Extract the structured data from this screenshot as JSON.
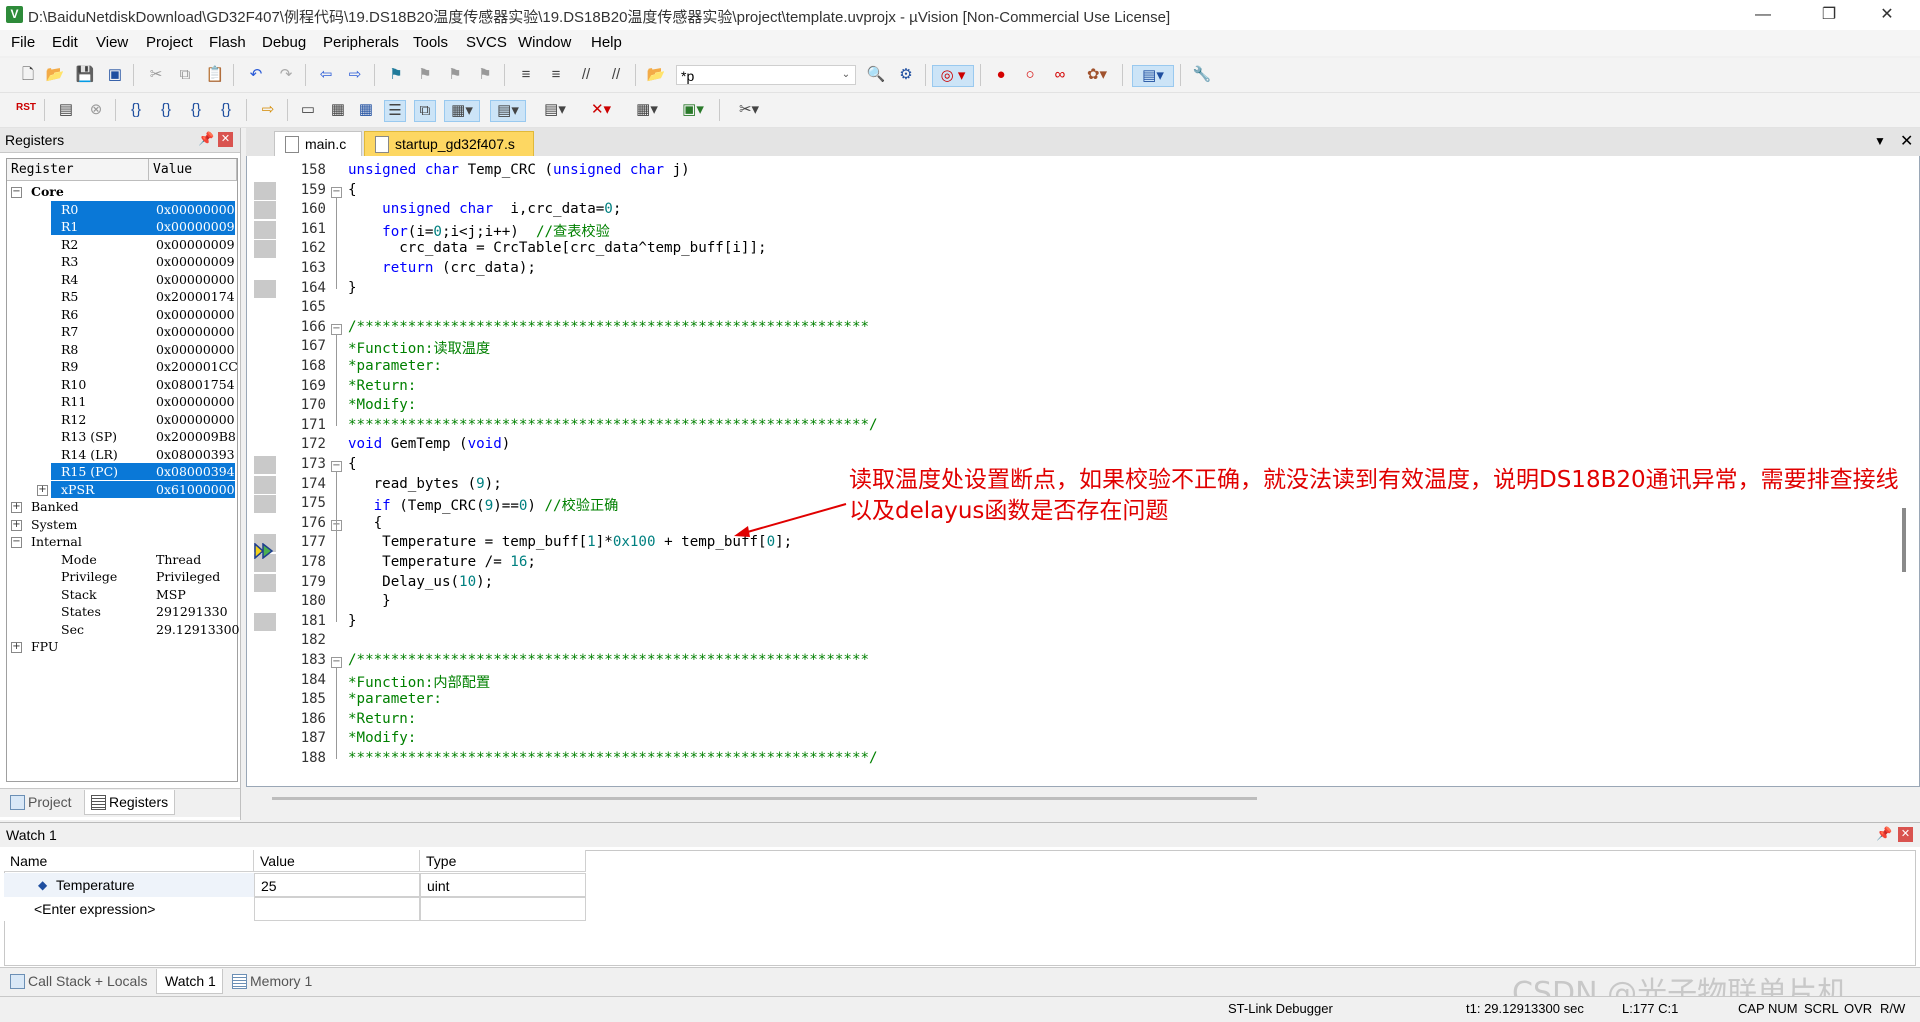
{
  "window": {
    "title": "D:\\BaiduNetdiskDownload\\GD32F407\\例程代码\\19.DS18B20温度传感器实验\\19.DS18B20温度传感器实验\\project\\template.uvprojx - µVision  [Non-Commercial Use License]",
    "app_icon_letter": "V",
    "minimize": "—",
    "maximize": "❐",
    "close": "✕"
  },
  "menu": [
    "File",
    "Edit",
    "View",
    "Project",
    "Flash",
    "Debug",
    "Peripherals",
    "Tools",
    "SVCS",
    "Window",
    "Help"
  ],
  "toolbar": {
    "find_text": "*p",
    "rst_label": "RST"
  },
  "registers": {
    "panel_title": "Registers",
    "col_register": "Register",
    "col_value": "Value",
    "groups": {
      "core": "Core",
      "banked": "Banked",
      "system": "System",
      "internal": "Internal",
      "fpu": "FPU"
    },
    "core": [
      {
        "name": "R0",
        "value": "0x00000000"
      },
      {
        "name": "R1",
        "value": "0x00000009"
      },
      {
        "name": "R2",
        "value": "0x00000009"
      },
      {
        "name": "R3",
        "value": "0x00000009"
      },
      {
        "name": "R4",
        "value": "0x00000000"
      },
      {
        "name": "R5",
        "value": "0x20000174"
      },
      {
        "name": "R6",
        "value": "0x00000000"
      },
      {
        "name": "R7",
        "value": "0x00000000"
      },
      {
        "name": "R8",
        "value": "0x00000000"
      },
      {
        "name": "R9",
        "value": "0x200001CC"
      },
      {
        "name": "R10",
        "value": "0x08001754"
      },
      {
        "name": "R11",
        "value": "0x00000000"
      },
      {
        "name": "R12",
        "value": "0x00000000"
      },
      {
        "name": "R13 (SP)",
        "value": "0x200009B8"
      },
      {
        "name": "R14 (LR)",
        "value": "0x08000393"
      },
      {
        "name": "R15 (PC)",
        "value": "0x08000394"
      },
      {
        "name": "xPSR",
        "value": "0x61000000"
      }
    ],
    "internal": [
      {
        "name": "Mode",
        "value": "Thread"
      },
      {
        "name": "Privilege",
        "value": "Privileged"
      },
      {
        "name": "Stack",
        "value": "MSP"
      },
      {
        "name": "States",
        "value": "291291330"
      },
      {
        "name": "Sec",
        "value": "29.12913300"
      }
    ]
  },
  "left_tabs": {
    "project": "Project",
    "registers": "Registers"
  },
  "editor": {
    "tabs": [
      "main.c",
      "startup_gd32f407.s"
    ],
    "lines": [
      {
        "n": "158",
        "text": "unsigned char Temp_CRC (unsigned char j)"
      },
      {
        "n": "159",
        "text": "{"
      },
      {
        "n": "160",
        "text": "    unsigned char  i,crc_data=0;"
      },
      {
        "n": "161",
        "text": "    for(i=0;i<j;i++)  //查表校验"
      },
      {
        "n": "162",
        "text": "      crc_data = CrcTable[crc_data^temp_buff[i]];"
      },
      {
        "n": "163",
        "text": "    return (crc_data);"
      },
      {
        "n": "164",
        "text": "}"
      },
      {
        "n": "165",
        "text": ""
      },
      {
        "n": "166",
        "text": "/************************************************************"
      },
      {
        "n": "167",
        "text": "*Function:读取温度"
      },
      {
        "n": "168",
        "text": "*parameter:"
      },
      {
        "n": "169",
        "text": "*Return:"
      },
      {
        "n": "170",
        "text": "*Modify:"
      },
      {
        "n": "171",
        "text": "*************************************************************/"
      },
      {
        "n": "172",
        "text": "void GemTemp (void)"
      },
      {
        "n": "173",
        "text": "{"
      },
      {
        "n": "174",
        "text": "   read_bytes (9);"
      },
      {
        "n": "175",
        "text": "   if (Temp_CRC(9)==0) //校验正确"
      },
      {
        "n": "176",
        "text": "   {"
      },
      {
        "n": "177",
        "text": "    Temperature = temp_buff[1]*0x100 + temp_buff[0];"
      },
      {
        "n": "178",
        "text": "    Temperature /= 16;"
      },
      {
        "n": "179",
        "text": "    Delay_us(10);"
      },
      {
        "n": "180",
        "text": "    }"
      },
      {
        "n": "181",
        "text": "}"
      },
      {
        "n": "182",
        "text": ""
      },
      {
        "n": "183",
        "text": "/************************************************************"
      },
      {
        "n": "184",
        "text": "*Function:内部配置"
      },
      {
        "n": "185",
        "text": "*parameter:"
      },
      {
        "n": "186",
        "text": "*Return:"
      },
      {
        "n": "187",
        "text": "*Modify:"
      },
      {
        "n": "188",
        "text": "*************************************************************/"
      }
    ],
    "annotation": "读取温度处设置断点，如果校验不正确，就没法读到有效温度，说明DS18B20通讯异常，需要排查接线以及delayus函数是否存在问题"
  },
  "watch": {
    "title": "Watch 1",
    "col_name": "Name",
    "col_value": "Value",
    "col_type": "Type",
    "rows": [
      {
        "name": "Temperature",
        "value": "25",
        "type": "uint"
      }
    ],
    "enter_expression": "<Enter expression>"
  },
  "bottom_tabs": [
    "Call Stack + Locals",
    "Watch 1",
    "Memory 1"
  ],
  "status": {
    "debugger": "ST-Link Debugger",
    "time": "t1: 29.12913300 sec",
    "position": "L:177 C:1",
    "caps": "CAP",
    "num": "NUM",
    "scrl": "SCRL",
    "ovr": "OVR",
    "rw": "R/W"
  },
  "watermark": "CSDN @光子物联单片机",
  "colors": {
    "selection": "#0a78d7",
    "keyword": "#0000ff",
    "comment": "#008000",
    "annotation": "#e00000",
    "active_tab": "#fdd762"
  }
}
